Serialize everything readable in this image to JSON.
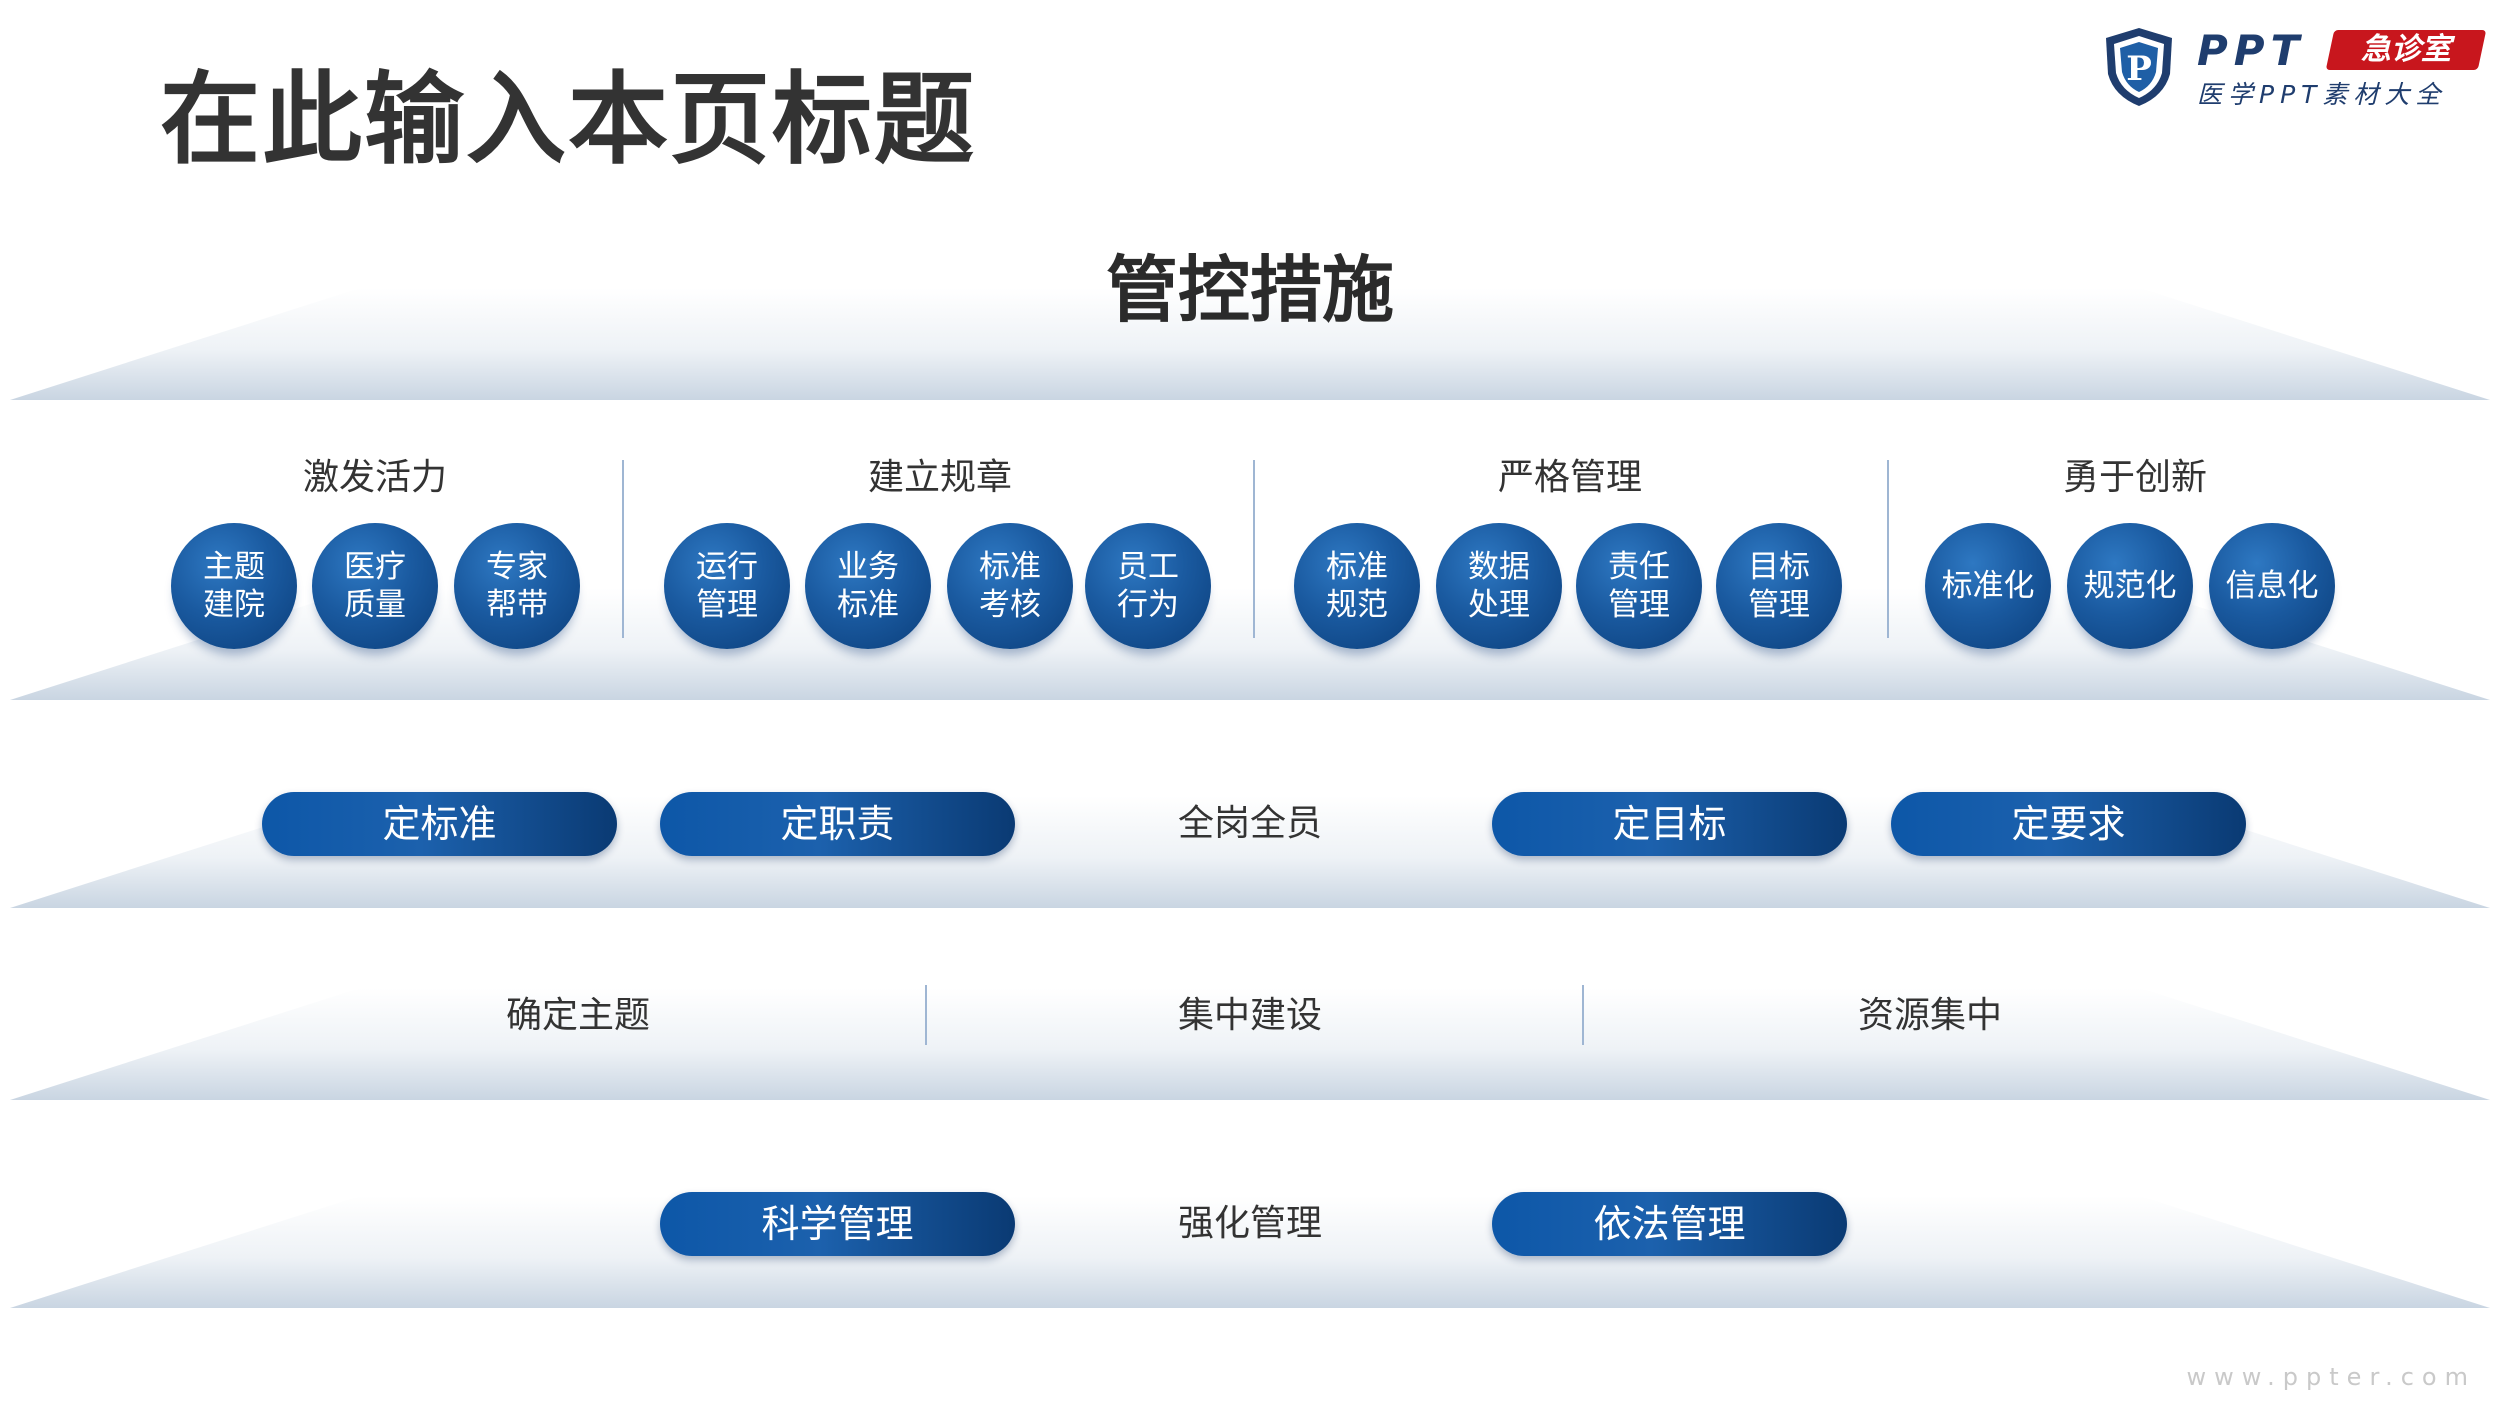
{
  "page_title": "在此输入本页标题",
  "logo": {
    "ppt": "PPT",
    "badge": "急诊室",
    "subtitle": "医学PPT素材大全",
    "shield_letter": "P"
  },
  "top_tier": {
    "label": "管控措施"
  },
  "tier1": {
    "groups": [
      {
        "title": "激发活力",
        "items": [
          {
            "l1": "主题",
            "l2": "建院"
          },
          {
            "l1": "医疗",
            "l2": "质量"
          },
          {
            "l1": "专家",
            "l2": "帮带"
          }
        ]
      },
      {
        "title": "建立规章",
        "items": [
          {
            "l1": "运行",
            "l2": "管理"
          },
          {
            "l1": "业务",
            "l2": "标准"
          },
          {
            "l1": "标准",
            "l2": "考核"
          },
          {
            "l1": "员工",
            "l2": "行为"
          }
        ]
      },
      {
        "title": "严格管理",
        "items": [
          {
            "l1": "标准",
            "l2": "规范"
          },
          {
            "l1": "数据",
            "l2": "处理"
          },
          {
            "l1": "责任",
            "l2": "管理"
          },
          {
            "l1": "目标",
            "l2": "管理"
          }
        ]
      },
      {
        "title": "勇于创新",
        "items": [
          {
            "l1": "标准化",
            "l2": ""
          },
          {
            "l1": "规范化",
            "l2": ""
          },
          {
            "l1": "信息化",
            "l2": ""
          }
        ]
      }
    ]
  },
  "tier2": {
    "pills": [
      "定标准",
      "定职责",
      "定目标",
      "定要求"
    ],
    "center": "全岗全员"
  },
  "tier3": {
    "items": [
      "确定主题",
      "集中建设",
      "资源集中"
    ]
  },
  "tier4": {
    "pills": [
      "科学管理",
      "依法管理"
    ],
    "center": "强化管理"
  },
  "watermark": "www.ppter.com",
  "colors": {
    "primary": "#0d57a8",
    "dark": "#0a3a73",
    "tier": "#d6e0ea"
  }
}
